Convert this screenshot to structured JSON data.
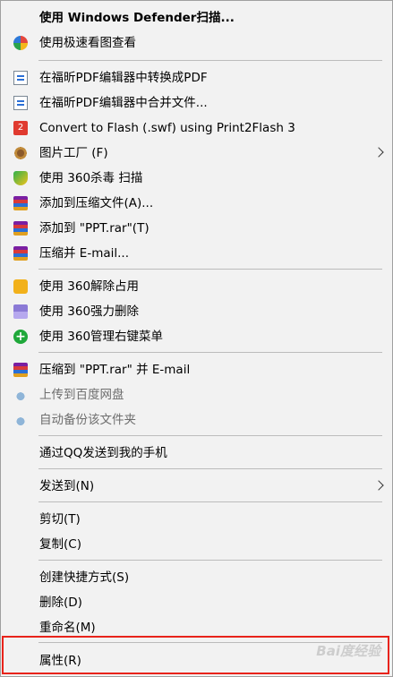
{
  "menu": {
    "items": [
      {
        "label": "使用 Windows Defender扫描...",
        "icon": "windows-defender-icon"
      },
      {
        "label": "使用极速看图查看",
        "icon": "image-viewer-icon"
      },
      {
        "label": "在福昕PDF编辑器中转换成PDF",
        "icon": "pdf-convert-icon"
      },
      {
        "label": "在福昕PDF编辑器中合并文件...",
        "icon": "pdf-merge-icon"
      },
      {
        "label": "Convert to Flash (.swf) using Print2Flash 3",
        "icon": "flash-icon"
      },
      {
        "label": "图片工厂 (F)",
        "icon": "gear-icon"
      },
      {
        "label": "使用 360杀毒 扫描",
        "icon": "360-shield-icon"
      },
      {
        "label": "添加到压缩文件(A)...",
        "icon": "winrar-icon"
      },
      {
        "label": "添加到 \"PPT.rar\"(T)",
        "icon": "winrar-icon"
      },
      {
        "label": "压缩并 E-mail...",
        "icon": "winrar-icon"
      },
      {
        "label": "使用 360解除占用",
        "icon": "360-unlock-icon"
      },
      {
        "label": "使用 360强力删除",
        "icon": "360-shred-icon"
      },
      {
        "label": "使用 360管理右键菜单",
        "icon": "360-plus-icon"
      },
      {
        "label": "压缩到 \"PPT.rar\" 并 E-mail",
        "icon": "winrar-icon"
      },
      {
        "label": "上传到百度网盘",
        "icon": "baidu-cloud-icon"
      },
      {
        "label": "自动备份该文件夹",
        "icon": "baidu-cloud-icon"
      },
      {
        "label": "通过QQ发送到我的手机"
      },
      {
        "label": "发送到(N)"
      },
      {
        "label": "剪切(T)"
      },
      {
        "label": "复制(C)"
      },
      {
        "label": "创建快捷方式(S)"
      },
      {
        "label": "删除(D)"
      },
      {
        "label": "重命名(M)"
      },
      {
        "label": "属性(R)"
      }
    ]
  },
  "watermark": "Bai度经验",
  "colors": {
    "menu_bg": "#f2f2f2",
    "highlight_border": "#e8231b",
    "separator": "#bcbcbc"
  }
}
